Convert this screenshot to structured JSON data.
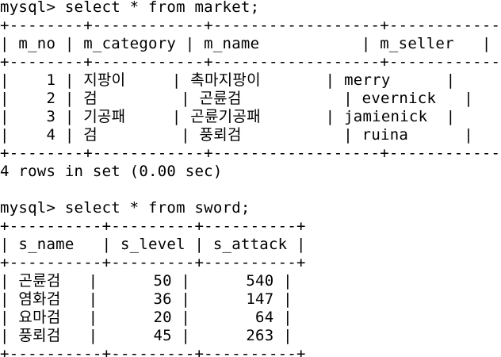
{
  "terminal": {
    "market_query": {
      "prompt": "mysql> select * from market;",
      "border": "+--------+------------+------------------+------------+",
      "header": "| m_no | m_category | m_name           | m_seller   |",
      "rows": [
        "|    1 | 지팡이     | 촉마지팡이       | merry      |",
        "|    2 | 검         | 곤륜검           | evernick   |",
        "|    3 | 기공패     | 곤륜기공패       | jamienick  |",
        "|    4 | 검         | 풍뢰검           | ruina      |"
      ],
      "result": "4 rows in set (0.00 sec)"
    },
    "sword_query": {
      "prompt": "mysql> select * from sword;",
      "border": "+----------+---------+----------+",
      "header": "| s_name   | s_level | s_attack |",
      "rows": [
        "| 곤륜검   |      50 |      540 |",
        "| 염화검   |      36 |      147 |",
        "| 요마검   |      20 |       64 |",
        "| 풍뢰검   |      45 |      263 |"
      ]
    }
  }
}
